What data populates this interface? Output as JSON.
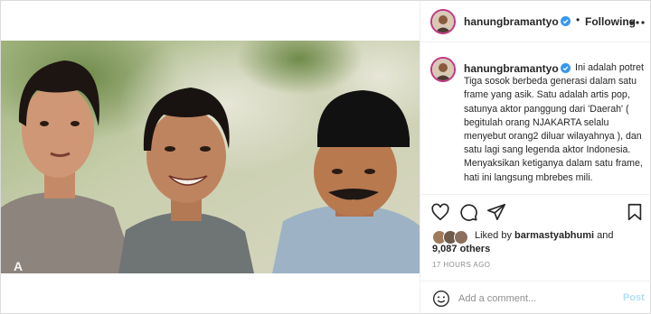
{
  "header": {
    "username": "hanungbramantyo",
    "separator": "•",
    "follow_status": "Following"
  },
  "caption": {
    "username": "hanungbramantyo",
    "text": "Ini adalah potret Tiga sosok berbeda generasi dalam satu frame yang asik. Satu adalah artis pop, satunya aktor panggung dari 'Daerah' ( begitulah orang NJAKARTA selalu menyebut orang2 diluar wilayahnya ), dan satu lagi sang legenda aktor Indonesia. Menyaksikan ketiganya dalam satu frame, hati ini langsung mbrebes mili."
  },
  "likes": {
    "prefix": "Liked by ",
    "user": "barmastyabhumi",
    "suffix": " and",
    "count": "9,087 others"
  },
  "timestamp": "17 HOURS AGO",
  "comment": {
    "placeholder": "Add a comment...",
    "post_label": "Post"
  },
  "icons": {
    "verified": "verified-badge-icon",
    "more": "more-options-icon",
    "like": "heart-icon",
    "comment": "comment-bubble-icon",
    "share": "paper-plane-icon",
    "save": "bookmark-icon",
    "emoji": "smiley-icon"
  },
  "colors": {
    "verified_blue": "#3897f0",
    "link_disabled": "#b2dffc",
    "secondary_text": "#8e8e8e",
    "border": "#dbdbdb"
  }
}
